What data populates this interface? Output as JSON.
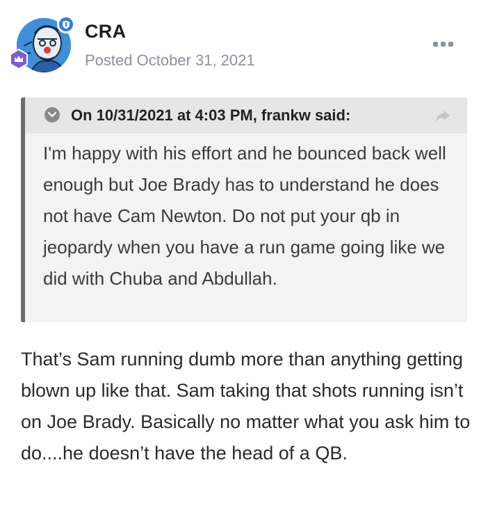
{
  "post": {
    "author": "CRA",
    "posted_label": "Posted October 31, 2021",
    "quote": {
      "citation": "On 10/31/2021 at 4:03 PM, frankw said:",
      "text": "I'm happy with his effort and he bounced back well enough but Joe Brady has to understand he does not have Cam Newton. Do not put your qb in jeopardy when you have a run game going like we did with Chuba and Abdullah."
    },
    "body": "That’s Sam running dumb more than anything getting blown up like that.   Sam taking that shots running isn’t on Joe Brady.  Basically no matter what you ask him to do....he doesn’t have the head of a QB."
  },
  "icons": {
    "online": "shield-icon",
    "rank": "crown-icon",
    "more": "ellipsis-icon",
    "toggle": "chevron-down-icon",
    "share": "share-arrow-icon"
  },
  "colors": {
    "accent_blue": "#2e7de1",
    "rank_purple": "#7e5bd6",
    "muted_gray": "#8a929c",
    "quote_bar": "#6b6b6b",
    "quote_bg": "#f3f3f3",
    "quote_header_bg": "#e6e6e6"
  }
}
